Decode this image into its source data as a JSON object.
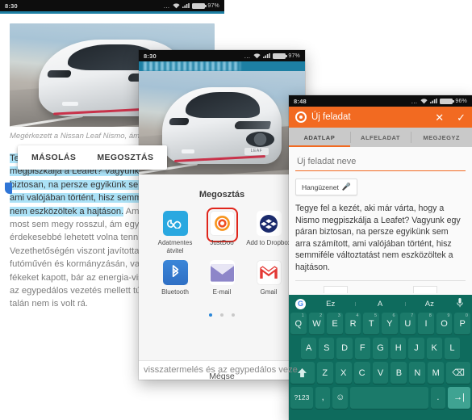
{
  "panel1": {
    "name": "article-reader",
    "statusbar": {
      "time": "8:30",
      "dots": "…",
      "battery": "97%"
    },
    "caption": "Megérkezett a Nissan Leaf Nismo, ám…",
    "context_menu": {
      "copy": "MÁSOLÁS",
      "share": "MEGOSZTÁS"
    },
    "body_selected": "Tegye fel a kezét, aki már várta, hogy a Nismo megpiszkálja a Leafet? Vagyunk egy páran biztosan, na persze egyikünk sem arra számított, ami valójában történt, hisz semmiféle változtatást nem eszközöltek a hajtáson.",
    "body_rest": " Ami nem baj, mert most sem megy rosszul, ám egy kis pluszt azért érdekesebbé lehetett volna tenni vele, ha lett. Vezethetőségén viszont javítottak, változtattak a futóművén és kormányzásán, valamint erősebb fékeket kapott, bár az energia-visszatermelés és az egypedálos vezetés mellett túl nagy szükség talán nem is volt rá."
  },
  "panel2": {
    "name": "share-sheet",
    "statusbar": {
      "time": "8:30",
      "dots": "…",
      "battery": "97%"
    },
    "sheet_title": "Megosztás",
    "apps": [
      {
        "label": "Adatmentes átvitel",
        "icon": "infinity-icon",
        "selected": false
      },
      {
        "label": "JustDoo",
        "icon": "justdoo-icon",
        "selected": true
      },
      {
        "label": "Add to Dropbox",
        "icon": "dropbox-icon",
        "selected": false
      },
      {
        "label": "Bluetooth",
        "icon": "bluetooth-icon",
        "selected": false
      },
      {
        "label": "E-mail",
        "icon": "envelope-icon",
        "selected": false
      },
      {
        "label": "Gmail",
        "icon": "gmail-icon",
        "selected": false
      }
    ],
    "page_dots": {
      "count": 3,
      "active": 0
    },
    "cancel_label": "Mégse",
    "under_text": "visszatermelés és az egypedálos veze",
    "highlight_color": "#e0251b"
  },
  "panel3": {
    "name": "justdoo-new-task",
    "statusbar": {
      "time": "8:48",
      "dots": "…",
      "battery": "96%"
    },
    "appbar": {
      "title": "Új feladat",
      "logo": "justdoo-logo-icon",
      "close": "✕",
      "confirm": "✓",
      "color": "#f26a21"
    },
    "tabs": [
      {
        "label": "ADATLAP",
        "active": true
      },
      {
        "label": "ALFELADAT",
        "active": false
      },
      {
        "label": "MEGJEGYZ",
        "active": false
      }
    ],
    "task_name_placeholder": "Új feladat neve",
    "task_name_value": "",
    "voice_button": "Hangüzenet",
    "description": "Tegye fel a kezét, aki már várta, hogy a Nismo megpiszkálja a Leafet? Vagyunk egy páran biztosan, na persze egyikünk sem arra számított, ami valójában történt, hisz semmiféle változtatást nem eszközöltek a hajtáson."
  },
  "keyboard": {
    "name": "gboard",
    "suggestions": [
      "Ez",
      "A",
      "Az"
    ],
    "row1": [
      {
        "k": "Q",
        "n": "1"
      },
      {
        "k": "W",
        "n": "2"
      },
      {
        "k": "E",
        "n": "3"
      },
      {
        "k": "R",
        "n": "4"
      },
      {
        "k": "T",
        "n": "5"
      },
      {
        "k": "Y",
        "n": "6"
      },
      {
        "k": "U",
        "n": "7"
      },
      {
        "k": "I",
        "n": "8"
      },
      {
        "k": "O",
        "n": "9"
      },
      {
        "k": "P",
        "n": "0"
      }
    ],
    "row2": [
      "A",
      "S",
      "D",
      "F",
      "G",
      "H",
      "J",
      "K",
      "L"
    ],
    "row3": [
      "Z",
      "X",
      "C",
      "V",
      "B",
      "N",
      "M"
    ],
    "shift": "⬆",
    "backspace": "⌫",
    "symbols": "?123",
    "comma": ",",
    "emoji": "☺",
    "space": "",
    "period": ".",
    "enter": "→|",
    "mic": "🎤",
    "bg_color": "#0e6b5d",
    "key_color": "#1b7a6a",
    "enter_color": "#3fa392"
  }
}
